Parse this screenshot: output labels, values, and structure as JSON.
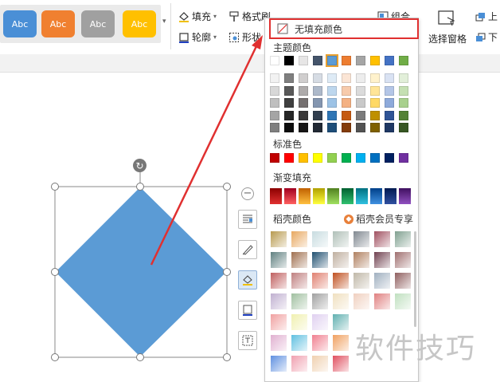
{
  "ribbon": {
    "styles": [
      {
        "label": "Abc",
        "color": "#4a8fd6"
      },
      {
        "label": "Abc",
        "color": "#f08030"
      },
      {
        "label": "Abc",
        "color": "#a0a0a0"
      },
      {
        "label": "Abc",
        "color": "#ffc000"
      }
    ],
    "fill_label": "填充",
    "outline_label": "轮廓",
    "format_painter_label": "格式刷",
    "shape_effects_label": "形状",
    "group_label": "组合",
    "selection_pane_label": "选择窗格",
    "up_label": "上",
    "down_label": "下"
  },
  "dropdown": {
    "no_fill_label": "无填充颜色",
    "theme_colors_title": "主题颜色",
    "standard_colors_title": "标准色",
    "gradient_fill_title": "渐变填充",
    "shell_colors_title": "稻壳颜色",
    "vip_label": "稻壳会员专享",
    "theme_top_row": [
      "#ffffff",
      "#000000",
      "#e7e6e6",
      "#44546a",
      "#5b9bd5",
      "#ed7d31",
      "#a5a5a5",
      "#ffc000",
      "#4472c4",
      "#70ad47"
    ],
    "theme_shades": [
      [
        "#f2f2f2",
        "#7f7f7f",
        "#d0cece",
        "#d6dce4",
        "#deebf6",
        "#fbe5d5",
        "#ededed",
        "#fff2cc",
        "#d9e2f3",
        "#e2efd9"
      ],
      [
        "#d8d8d8",
        "#595959",
        "#aeabab",
        "#adb9ca",
        "#bdd7ee",
        "#f7cbac",
        "#dbdbdb",
        "#ffe598",
        "#b4c6e7",
        "#c5e0b3"
      ],
      [
        "#bfbfbf",
        "#3f3f3f",
        "#757070",
        "#8496b0",
        "#9dc3e6",
        "#f4b183",
        "#c9c9c9",
        "#ffd965",
        "#8eaadb",
        "#a8d08d"
      ],
      [
        "#a5a5a5",
        "#262626",
        "#3a3838",
        "#323f4f",
        "#2e75b5",
        "#c55a11",
        "#7b7b7b",
        "#bf9000",
        "#2f5496",
        "#538135"
      ],
      [
        "#7f7f7f",
        "#0d0d0d",
        "#171616",
        "#222a35",
        "#1e4e79",
        "#833c0b",
        "#525252",
        "#7f6000",
        "#1f3864",
        "#375623"
      ]
    ],
    "standard_colors": [
      "#c00000",
      "#ff0000",
      "#ffc000",
      "#ffff00",
      "#92d050",
      "#00b050",
      "#00b0f0",
      "#0070c0",
      "#002060",
      "#7030a0"
    ],
    "gradient_colors": [
      [
        "#8b0000",
        "#e03030"
      ],
      [
        "#a00020",
        "#ff6060"
      ],
      [
        "#c06000",
        "#ffc040"
      ],
      [
        "#b0a000",
        "#ffff40"
      ],
      [
        "#508020",
        "#a0e060"
      ],
      [
        "#006030",
        "#30c070"
      ],
      [
        "#007080",
        "#30c0e0"
      ],
      [
        "#00408a",
        "#4090e0"
      ],
      [
        "#001a50",
        "#3050a0"
      ],
      [
        "#401060",
        "#9050c0"
      ]
    ],
    "texture_colors": [
      [
        "#b89a50",
        "#e8a860",
        "#c8dce0",
        "#b0c0b8",
        "#808890",
        "#a05060",
        "#80a090"
      ],
      [
        "#608080",
        "#a07050",
        "#205070",
        "#c0b0a0",
        "#b08060",
        "#704050",
        "#a07070"
      ],
      [
        "#c06060",
        "#c08080",
        "#e08070",
        "#c05020",
        "#c0b8a8",
        "#a0b0c0",
        "#906060"
      ],
      [
        "#c0b0d0",
        "#a0c0a0",
        "#a0a0a0",
        "#f0e0c0",
        "#f0d0c0",
        "#e08080",
        "#c0e0c0"
      ],
      [
        "#f0a0a0",
        "#f0f0b0",
        "#e0d0f0",
        "#60b0b0"
      ],
      [
        "#e0b0d0",
        "#60c0e0",
        "#f08090",
        "#f0a060"
      ],
      [
        "#6090e0",
        "#f0a0b0",
        "#f0d0b0",
        "#e05060"
      ]
    ]
  },
  "shape": {
    "fill_color": "#5b9bd5"
  },
  "side_tools": [
    "minus-icon",
    "wrap-text-icon",
    "pen-icon",
    "fill-bucket-icon",
    "outline-icon",
    "text-box-icon"
  ],
  "annotation": {
    "arrow_color": "#e03030"
  },
  "watermark": "软件技巧"
}
